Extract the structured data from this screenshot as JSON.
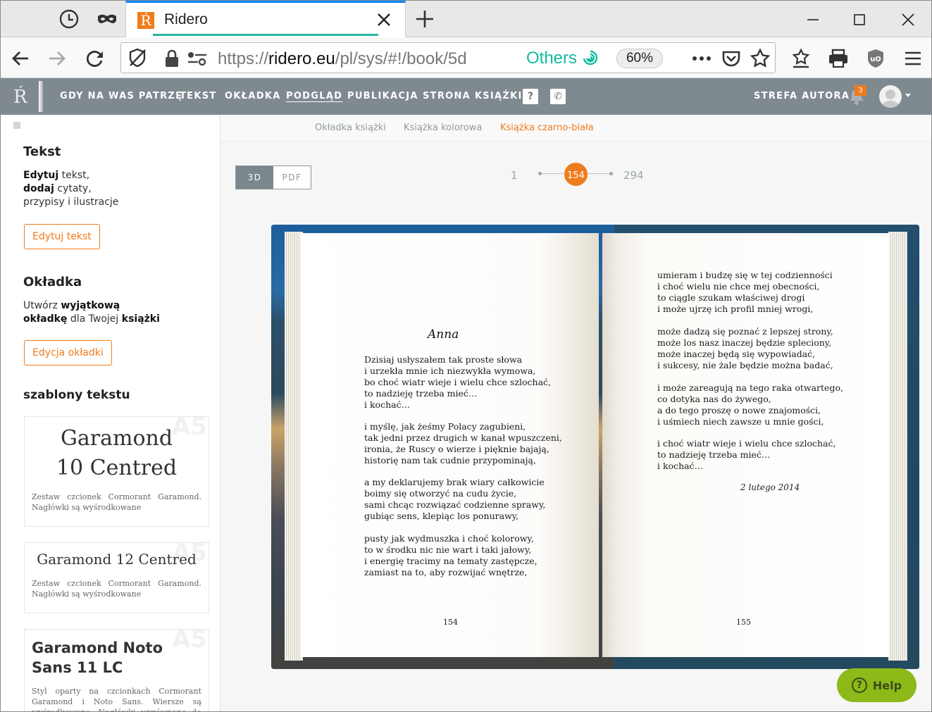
{
  "browser": {
    "tab_title": "Ridero",
    "favicon_letter": "Ŕ",
    "url_prefix": "https://",
    "url_host": "ridero.eu",
    "url_path": "/pl/sys/#!/book/5d",
    "container_label": "Others",
    "zoom": "60%",
    "accent_color": "#0a84ff"
  },
  "site": {
    "logo": "Ŕ",
    "nav": [
      "GDY NA WAS PATRZĘ",
      "TEKST",
      "OKŁADKA",
      "PODGLĄD",
      "PUBLIKACJA",
      "STRONA KSIĄŻKI"
    ],
    "nav_active": "PODGLĄD",
    "help_square": "?",
    "phone_square": "✆",
    "author_zone": "STREFA AUTORA",
    "notifications": "3",
    "brand_color": "#ef7c1c"
  },
  "sidebar": {
    "text_heading": "Tekst",
    "text_line1_bold": "Edytuj",
    "text_line1": " tekst,",
    "text_line2_bold": "dodaj",
    "text_line2": " cytaty,",
    "text_line3": "przypisy i ilustracje",
    "edit_text_button": "Edytuj tekst",
    "cover_heading": "Okładka",
    "cover_line1": "Utwórz ",
    "cover_line1_bold": "wyjątkową",
    "cover_line2_bold": "okładkę",
    "cover_line2": " dla Twojej ",
    "cover_line2_bold2": "książki",
    "edit_cover_button": "Edycja okładki",
    "templates_heading": "szablony tekstu",
    "templates": [
      {
        "badge": "A5",
        "title": "Garamond 10 Centred",
        "desc": "Zestaw czcionek Cormorant Garamond. Nagłówki są wyśrodkowane"
      },
      {
        "badge": "A5",
        "title": "Garamond 12 Centred",
        "desc": "Zestaw czcionek Cormorant Garamond. Nagłówki są wyśrodkowane"
      },
      {
        "badge": "A5",
        "title": "Garamond Noto Sans 11 LC",
        "desc": "Styl oparty na czcionkach Cormorant Garamond i Noto Sans. Wiersze są wyśrodkowane. Nagłówki wyrównane do lewej"
      }
    ]
  },
  "preview": {
    "subtabs": [
      "Okładka książki",
      "Książka kolorowa",
      "Książka czarno-biała"
    ],
    "subtab_active": "Książka czarno-biała",
    "mode_3d": "3D",
    "mode_pdf": "PDF",
    "page_first": "1",
    "page_current": "154",
    "page_last": "294",
    "left_page": {
      "title": "Anna",
      "stanzas": [
        "Dzisiaj usłyszałem tak proste słowa\ni urzekła mnie ich niezwykła wymowa,\nbo choć wiatr wieje i wielu chce szlochać,\nto nadzieję trzeba mieć…\ni kochać…",
        "i myślę, jak żeśmy Polacy zagubieni,\ntak jedni przez drugich w kanał wpuszczeni,\nironia, że Ruscy o wierze i pięknie bajają,\nhistorię nam tak cudnie przypominają,",
        "a my deklarujemy brak wiary całkowicie\nboimy się otworzyć na cudu życie,\nsami chcąc rozwiązać codzienne sprawy,\ngubiąc sens, klepiąc los ponurawy,",
        "pusty jak wydmuszka i choć kolorowy,\nto w środku nic nie wart i taki jałowy,\ni energię tracimy na tematy zastępcze,\nzamiast na to, aby rozwijać wnętrze,"
      ],
      "page_number": "154"
    },
    "right_page": {
      "stanzas": [
        "umieram i budzę się w tej codzienności\ni choć wielu nie chce mej obecności,\nto ciągle szukam właściwej drogi\ni może ujrzę ich profil mniej wrogi,",
        "może dadzą się poznać z lepszej strony,\nmoże los nasz inaczej będzie spleciony,\nmoże inaczej będą się wypowiadać,\ni sukcesy, nie żale będzie można badać,",
        "i może zareagują na tego raka otwartego,\nco dotyka nas do żywego,\na do tego proszę o nowe znajomości,\ni uśmiech niech zawsze u mnie gości,",
        "i choć wiatr wieje i wielu chce szlochać,\nto nadzieję trzeba mieć…\ni kochać…"
      ],
      "date": "2 lutego 2014",
      "page_number": "155"
    },
    "help_label": "Help",
    "help_color": "#8dba18"
  },
  "icons": [
    "history-icon",
    "private-mask-icon",
    "close-icon",
    "plus-icon",
    "minimize-icon",
    "maximize-icon",
    "back-arrow-icon",
    "forward-arrow-icon",
    "reload-icon",
    "tracking-shield-icon",
    "lock-icon",
    "permissions-icon",
    "fingerprint-icon",
    "more-icon",
    "pocket-icon",
    "star-icon",
    "bookmarks-icon",
    "print-icon",
    "ublock-icon",
    "menu-icon",
    "bell-icon",
    "avatar-icon",
    "help-icon"
  ]
}
